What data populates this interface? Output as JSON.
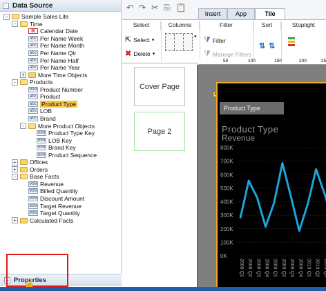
{
  "data_source": {
    "title": "Data Source",
    "tree": [
      {
        "label": "Sample Sales Lite",
        "icon": "folder-open",
        "toggle": "-"
      },
      {
        "label": "Time",
        "icon": "folder-open",
        "toggle": "-"
      },
      {
        "label": "Calendar Date",
        "icon": "calendar-attribute"
      },
      {
        "label": "Per Name Week",
        "icon": "text-attribute"
      },
      {
        "label": "Per Name Month",
        "icon": "text-attribute"
      },
      {
        "label": "Per Name Qtr",
        "icon": "text-attribute"
      },
      {
        "label": "Per Name Half",
        "icon": "text-attribute"
      },
      {
        "label": "Per Name Year",
        "icon": "text-attribute"
      },
      {
        "label": "More Time Objects",
        "icon": "folder",
        "toggle": "+"
      },
      {
        "label": "Products",
        "icon": "folder-open",
        "toggle": "-"
      },
      {
        "label": "Product Number",
        "icon": "numeric-attribute"
      },
      {
        "label": "Product",
        "icon": "text-attribute"
      },
      {
        "label": "Product Type",
        "icon": "text-attribute",
        "selected": true
      },
      {
        "label": "LOB",
        "icon": "text-attribute"
      },
      {
        "label": "Brand",
        "icon": "text-attribute"
      },
      {
        "label": "More Product Objects",
        "icon": "folder-open",
        "toggle": "-"
      },
      {
        "label": "Product Type Key",
        "icon": "numeric-attribute"
      },
      {
        "label": "LOB Key",
        "icon": "numeric-attribute"
      },
      {
        "label": "Brand Key",
        "icon": "numeric-attribute"
      },
      {
        "label": "Product Sequence",
        "icon": "numeric-attribute"
      },
      {
        "label": "Offices",
        "icon": "folder",
        "toggle": "+"
      },
      {
        "label": "Orders",
        "icon": "folder",
        "toggle": "+"
      },
      {
        "label": "Base Facts",
        "icon": "folder-open",
        "toggle": "-"
      },
      {
        "label": "Revenue",
        "icon": "numeric-attribute"
      },
      {
        "label": "Billed Quantity",
        "icon": "numeric-attribute"
      },
      {
        "label": "Discount Amount",
        "icon": "numeric-attribute"
      },
      {
        "label": "Target Revenue",
        "icon": "numeric-attribute"
      },
      {
        "label": "Target Quantity",
        "icon": "numeric-attribute"
      },
      {
        "label": "Calculated Facts",
        "icon": "folder",
        "toggle": "+"
      }
    ],
    "properties_label": "Properties",
    "expand_symbol": "+",
    "collapse_symbol": "-"
  },
  "ribbon": {
    "tabs": [
      "Insert",
      "App",
      "Tile"
    ],
    "active_tab": "Tile",
    "groups": [
      "Select",
      "Columns",
      "Filter",
      "Sort",
      "Stoplight"
    ],
    "select_label": "Select",
    "delete_label": "Delete",
    "filter_label": "Filter",
    "manage_filters_label": "Manage Filters"
  },
  "ruler": [
    "50",
    "100",
    "150",
    "200",
    "250"
  ],
  "pages": [
    "Cover Page",
    "Page 2"
  ],
  "tile": {
    "tab_label": "Product Type",
    "title": "Product Type",
    "subtitle": "Revenue"
  },
  "chart_data": {
    "type": "line",
    "title": "Product Type",
    "subtitle": "Revenue",
    "y_ticks": [
      "800K",
      "700K",
      "600K",
      "500K",
      "400K",
      "300K",
      "200K",
      "100K",
      "0K"
    ],
    "ylim": [
      0,
      800000
    ],
    "x_tick_labels": [
      "2008 Q1",
      "2008 Q2",
      "2008 Q3",
      "2008 Q4",
      "2009 Q1",
      "2009 Q2",
      "2009 Q3",
      "2009 Q4",
      "2010 Q1",
      "2010 Q2",
      "2010 Q3",
      "2010 Q4"
    ],
    "series": [
      {
        "values": [
          280000,
          555000,
          430000,
          215000,
          390000,
          685000,
          440000,
          185000,
          380000,
          640000,
          460000,
          260000
        ],
        "color": "#1fa3d8"
      }
    ],
    "grid": true
  }
}
